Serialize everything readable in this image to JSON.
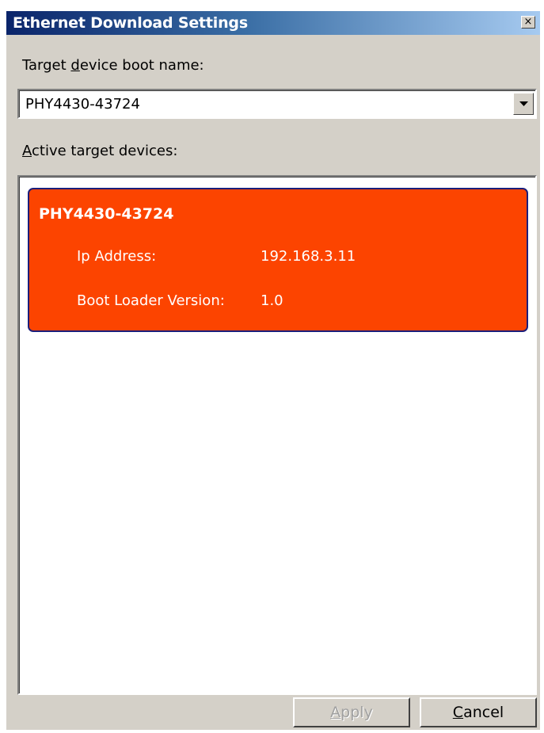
{
  "window": {
    "title": "Ethernet Download Settings",
    "close_glyph": "×"
  },
  "boot_name": {
    "label_before": "Target ",
    "label_mnemonic": "d",
    "label_after": "evice boot name:",
    "value": "PHY4430-43724"
  },
  "devices": {
    "label_mnemonic": "A",
    "label_after": "ctive target devices:",
    "items": [
      {
        "name": "PHY4430-43724",
        "ip_label": "Ip Address:",
        "ip_value": "192.168.3.11",
        "bootloader_label": "Boot Loader Version:",
        "bootloader_value": "1.0"
      }
    ]
  },
  "buttons": {
    "apply_mnemonic": "A",
    "apply_rest": "pply",
    "cancel_mnemonic": "C",
    "cancel_rest": "ancel"
  },
  "colors": {
    "selected_card": "#fc4400",
    "title_gradient_start": "#0a246a",
    "title_gradient_end": "#a6caf0"
  },
  "icons": {
    "close": "close-icon",
    "dropdown": "chevron-down-icon"
  }
}
